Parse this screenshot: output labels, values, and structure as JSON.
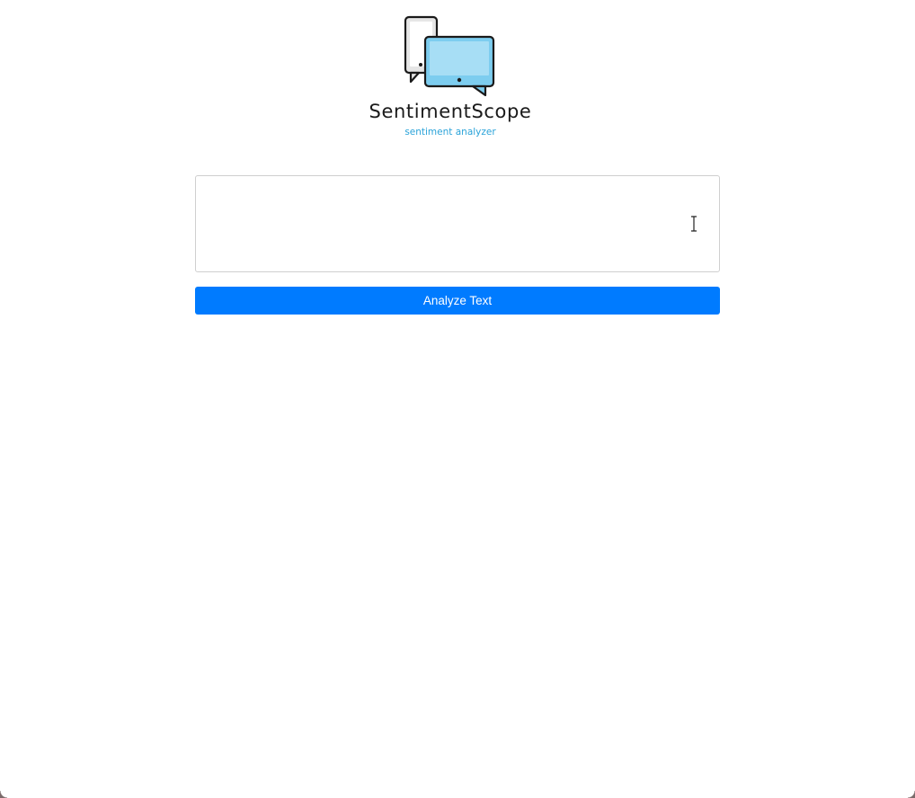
{
  "brand": {
    "name": "SentimentScope",
    "tagline": "sentiment analyzer",
    "logo_icon": "chat-devices-icon",
    "accent_color": "#2aa3d9"
  },
  "analyzer": {
    "input_value": "",
    "input_placeholder": "",
    "button_label": "Analyze Text",
    "button_color": "#007bff"
  },
  "cursor": {
    "icon": "text-cursor-icon"
  }
}
